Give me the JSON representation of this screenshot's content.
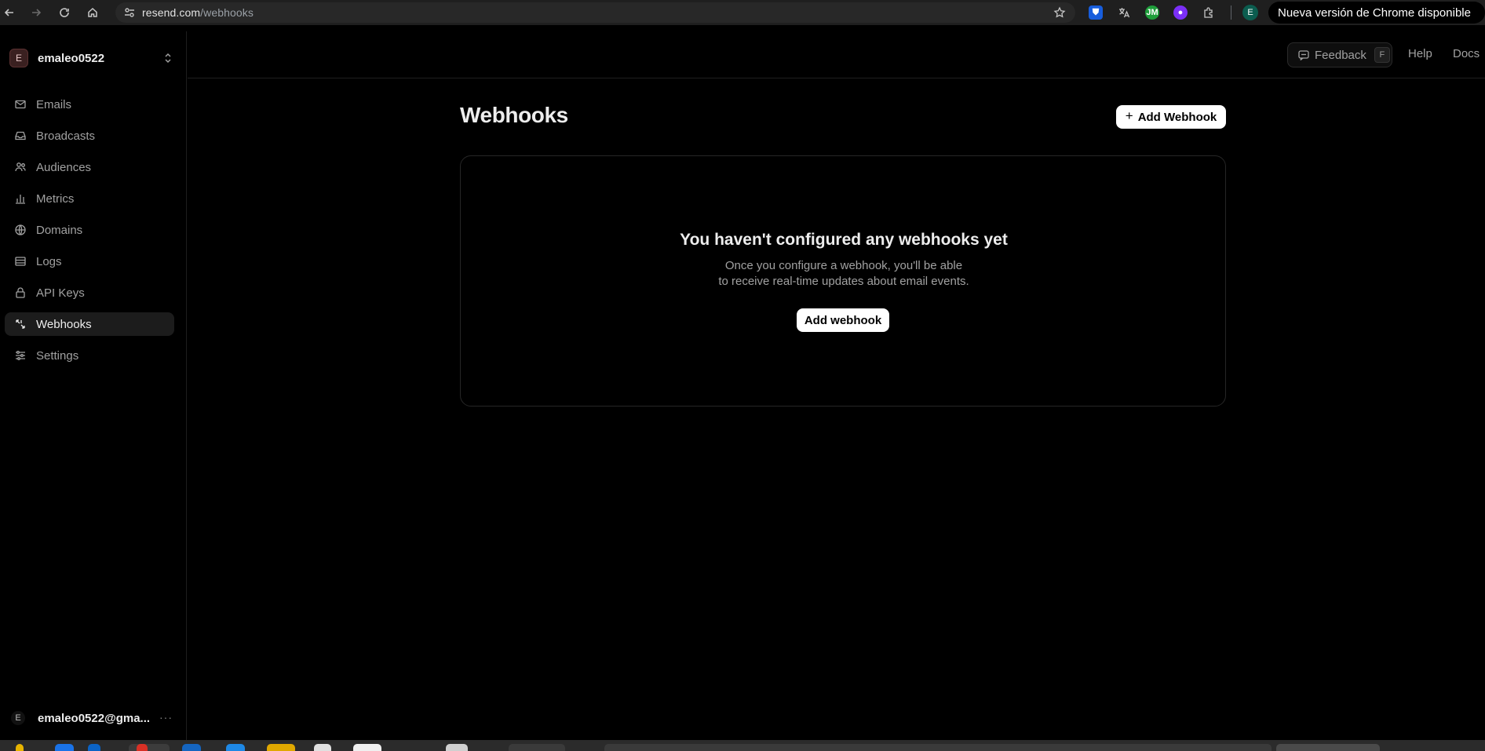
{
  "browser": {
    "url_host": "resend.com",
    "url_path": "/webhooks",
    "profile_initial": "E",
    "update_banner": "Nueva versión de Chrome disponible",
    "extensions": [
      {
        "icon": "bitwarden-shield-icon",
        "color": "#175ddc"
      },
      {
        "icon": "translate-icon",
        "color": "#c7c7c7"
      },
      {
        "icon": "jm-extension-icon",
        "color": "#1e9e3a"
      },
      {
        "icon": "chat-bubble-icon",
        "color": "#7b2ff7"
      },
      {
        "icon": "puzzle-extensions-icon",
        "color": "#c7c7c7"
      }
    ]
  },
  "sidebar": {
    "team_initial": "E",
    "team_name": "emaleo0522",
    "items": [
      {
        "label": "Emails",
        "icon": "mail-icon"
      },
      {
        "label": "Broadcasts",
        "icon": "inbox-icon"
      },
      {
        "label": "Audiences",
        "icon": "users-icon"
      },
      {
        "label": "Metrics",
        "icon": "bar-chart-icon"
      },
      {
        "label": "Domains",
        "icon": "globe-icon"
      },
      {
        "label": "Logs",
        "icon": "logs-icon"
      },
      {
        "label": "API Keys",
        "icon": "lock-icon"
      },
      {
        "label": "Webhooks",
        "icon": "webhook-icon",
        "active": true
      },
      {
        "label": "Settings",
        "icon": "sliders-icon"
      }
    ],
    "user_initial": "E",
    "user_email": "emaleo0522@gma...",
    "user_more": "···"
  },
  "topbar": {
    "feedback_label": "Feedback",
    "feedback_shortcut": "F",
    "help_label": "Help",
    "docs_label": "Docs"
  },
  "main": {
    "title": "Webhooks",
    "add_button_label": "Add Webhook",
    "empty_title": "You haven't configured any webhooks yet",
    "empty_line1": "Once you configure a webhook, you'll be able",
    "empty_line2": "to receive real-time updates about email events.",
    "empty_button_label": "Add webhook"
  },
  "colors": {
    "background": "#000000",
    "active_nav": "#1c1c1c",
    "primary_button": "#ffffff"
  }
}
